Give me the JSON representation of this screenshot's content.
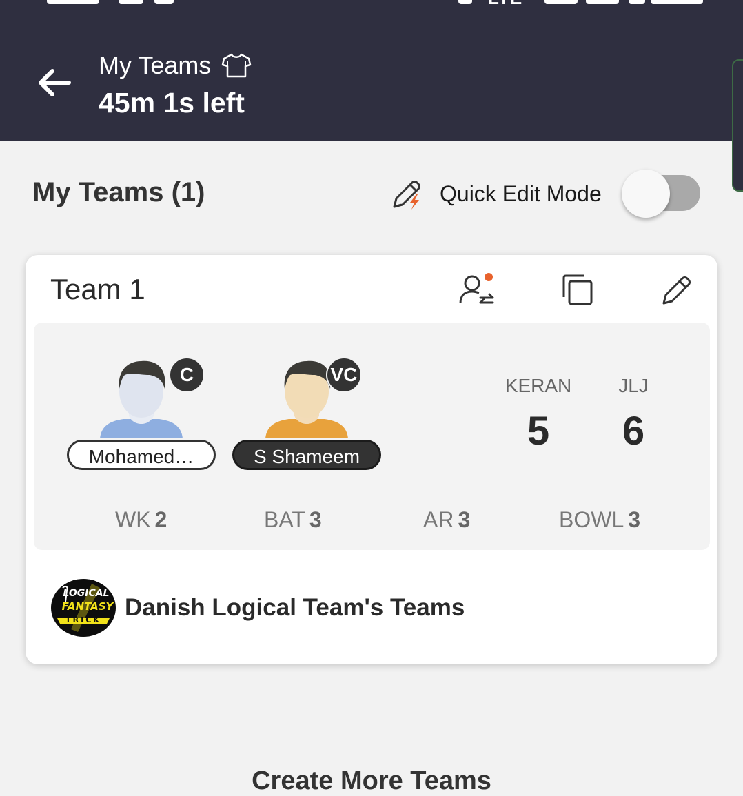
{
  "header": {
    "title": "My Teams",
    "timer": "45m 1s left",
    "status_network": "LTE"
  },
  "section": {
    "title": "My Teams (1)",
    "quick_edit_label": "Quick Edit Mode",
    "quick_edit_on": false
  },
  "team": {
    "name": "Team 1",
    "captain": {
      "badge": "C",
      "name": "Mohamed…"
    },
    "vice_captain": {
      "badge": "VC",
      "name": "S Shameem"
    },
    "teams": [
      {
        "code": "KERAN",
        "count": "5"
      },
      {
        "code": "JLJ",
        "count": "6"
      }
    ],
    "roles": [
      {
        "label": "WK",
        "count": "2"
      },
      {
        "label": "BAT",
        "count": "3"
      },
      {
        "label": "AR",
        "count": "3"
      },
      {
        "label": "BOWL",
        "count": "3"
      }
    ],
    "owner": {
      "name": "Danish Logical Team's Teams",
      "logo_text": [
        "LOGICAL",
        "FANTASY",
        "TRICK"
      ]
    }
  },
  "footer": {
    "create_more": "Create More Teams"
  },
  "colors": {
    "header_bg": "#2f2f40",
    "page_bg": "#f2f2f2",
    "accent_orange": "#e8622c",
    "captain_shirt": "#8eaee0",
    "vice_captain_shirt": "#e8a23c",
    "logo_yellow": "#f2e21a"
  }
}
